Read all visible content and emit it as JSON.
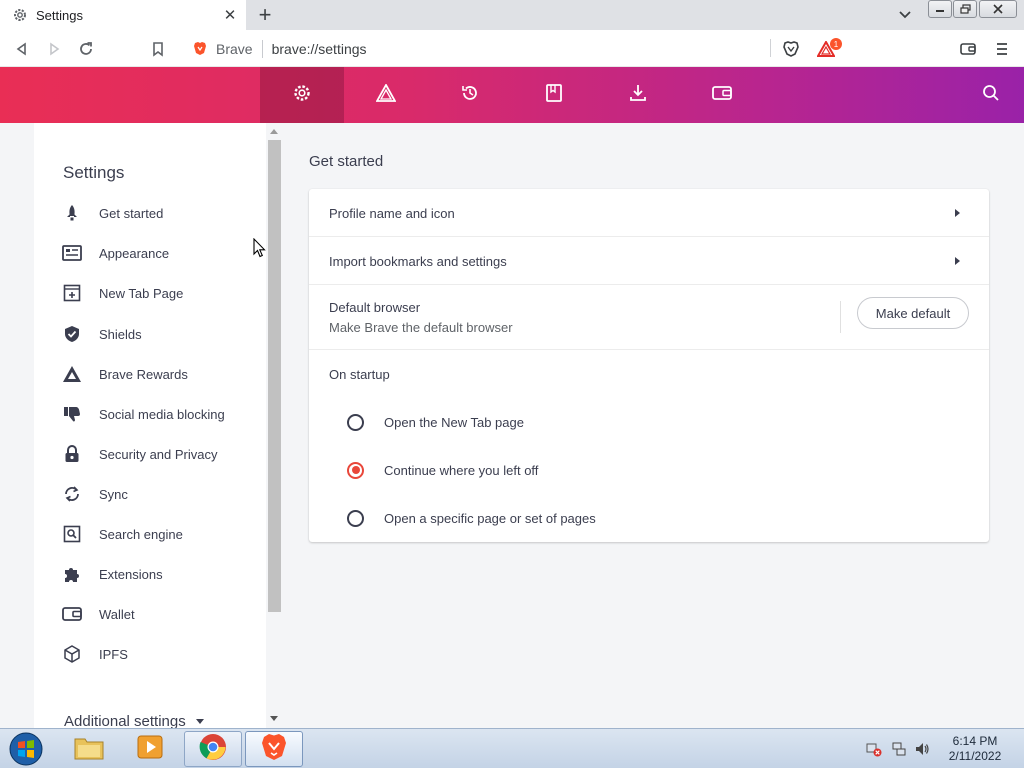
{
  "browser": {
    "tab": {
      "title": "Settings",
      "icon": "gear-icon"
    },
    "toolbar": {
      "brand": "Brave",
      "url": "brave://settings",
      "rewards_badge_count": "1"
    }
  },
  "settings_header": {
    "nav_icons": [
      "gear-icon",
      "rewards-triangle-icon",
      "history-icon",
      "bookmarks-icon",
      "downloads-icon",
      "wallet-icon"
    ],
    "active": "gear-icon"
  },
  "sidebar": {
    "title": "Settings",
    "items": [
      {
        "label": "Get started",
        "icon": "rocket-icon"
      },
      {
        "label": "Appearance",
        "icon": "appearance-icon"
      },
      {
        "label": "New Tab Page",
        "icon": "new-tab-icon"
      },
      {
        "label": "Shields",
        "icon": "shield-icon"
      },
      {
        "label": "Brave Rewards",
        "icon": "rewards-triangle-icon"
      },
      {
        "label": "Social media blocking",
        "icon": "thumbs-down-icon"
      },
      {
        "label": "Security and Privacy",
        "icon": "lock-icon"
      },
      {
        "label": "Sync",
        "icon": "sync-icon"
      },
      {
        "label": "Search engine",
        "icon": "search-engine-icon"
      },
      {
        "label": "Extensions",
        "icon": "puzzle-icon"
      },
      {
        "label": "Wallet",
        "icon": "wallet-icon"
      },
      {
        "label": "IPFS",
        "icon": "cube-icon"
      }
    ],
    "additional": "Additional settings"
  },
  "main": {
    "section_title": "Get started",
    "rows": {
      "profile": "Profile name and icon",
      "import": "Import bookmarks and settings",
      "default_title": "Default browser",
      "default_sub": "Make Brave the default browser",
      "default_button": "Make default",
      "startup_title": "On startup"
    },
    "startup_options": [
      {
        "label": "Open the New Tab page",
        "checked": false
      },
      {
        "label": "Continue where you left off",
        "checked": true
      },
      {
        "label": "Open a specific page or set of pages",
        "checked": false
      }
    ]
  },
  "taskbar": {
    "apps": [
      "explorer-icon",
      "media-player-icon",
      "chrome-icon",
      "brave-icon"
    ],
    "active_app": "brave-icon",
    "time": "6:14 PM",
    "date": "2/11/2022"
  },
  "colors": {
    "header_start": "#e92e55",
    "header_end": "#9a22a8",
    "radio_accent": "#e9473a"
  }
}
